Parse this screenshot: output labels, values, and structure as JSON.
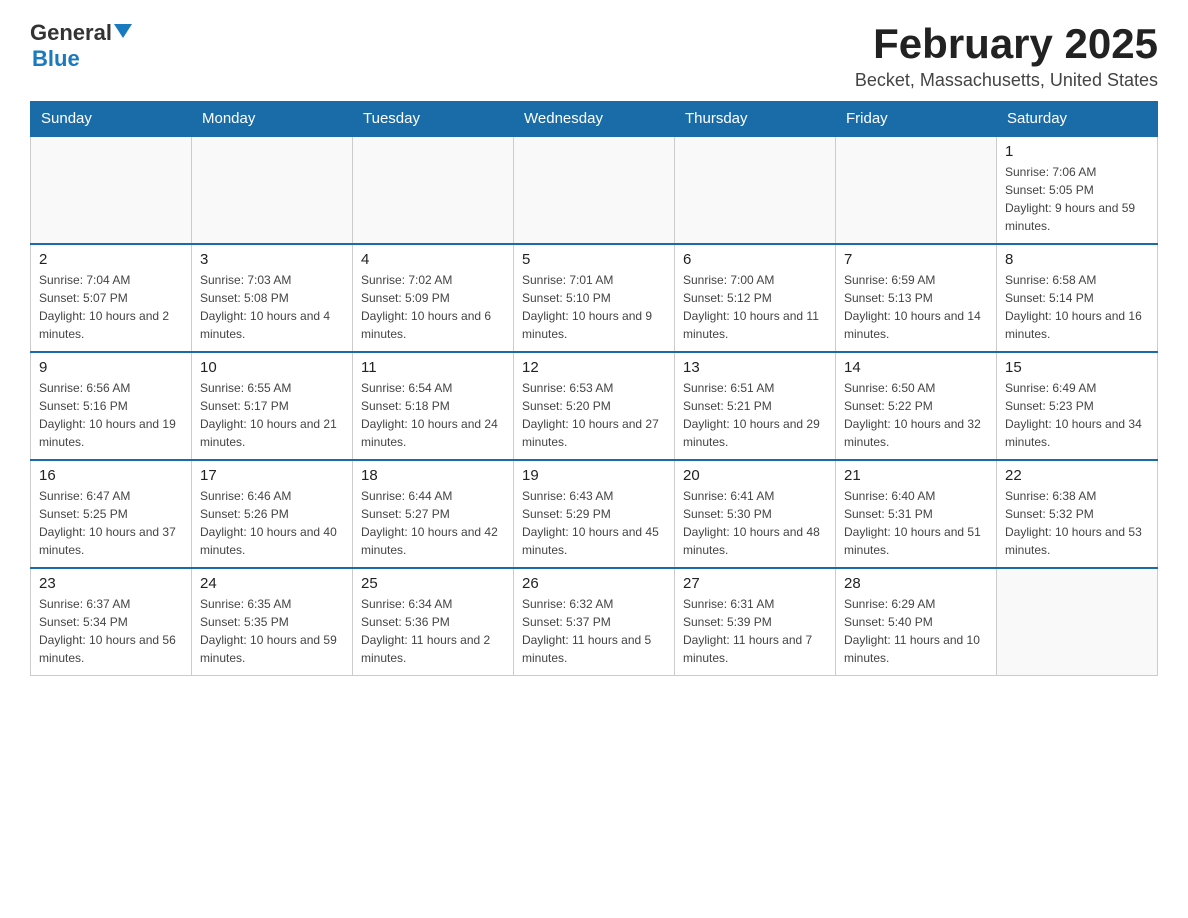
{
  "header": {
    "logo_general": "General",
    "logo_blue": "Blue",
    "month_title": "February 2025",
    "location": "Becket, Massachusetts, United States"
  },
  "weekdays": [
    "Sunday",
    "Monday",
    "Tuesday",
    "Wednesday",
    "Thursday",
    "Friday",
    "Saturday"
  ],
  "weeks": [
    [
      {
        "day": "",
        "info": ""
      },
      {
        "day": "",
        "info": ""
      },
      {
        "day": "",
        "info": ""
      },
      {
        "day": "",
        "info": ""
      },
      {
        "day": "",
        "info": ""
      },
      {
        "day": "",
        "info": ""
      },
      {
        "day": "1",
        "info": "Sunrise: 7:06 AM\nSunset: 5:05 PM\nDaylight: 9 hours and 59 minutes."
      }
    ],
    [
      {
        "day": "2",
        "info": "Sunrise: 7:04 AM\nSunset: 5:07 PM\nDaylight: 10 hours and 2 minutes."
      },
      {
        "day": "3",
        "info": "Sunrise: 7:03 AM\nSunset: 5:08 PM\nDaylight: 10 hours and 4 minutes."
      },
      {
        "day": "4",
        "info": "Sunrise: 7:02 AM\nSunset: 5:09 PM\nDaylight: 10 hours and 6 minutes."
      },
      {
        "day": "5",
        "info": "Sunrise: 7:01 AM\nSunset: 5:10 PM\nDaylight: 10 hours and 9 minutes."
      },
      {
        "day": "6",
        "info": "Sunrise: 7:00 AM\nSunset: 5:12 PM\nDaylight: 10 hours and 11 minutes."
      },
      {
        "day": "7",
        "info": "Sunrise: 6:59 AM\nSunset: 5:13 PM\nDaylight: 10 hours and 14 minutes."
      },
      {
        "day": "8",
        "info": "Sunrise: 6:58 AM\nSunset: 5:14 PM\nDaylight: 10 hours and 16 minutes."
      }
    ],
    [
      {
        "day": "9",
        "info": "Sunrise: 6:56 AM\nSunset: 5:16 PM\nDaylight: 10 hours and 19 minutes."
      },
      {
        "day": "10",
        "info": "Sunrise: 6:55 AM\nSunset: 5:17 PM\nDaylight: 10 hours and 21 minutes."
      },
      {
        "day": "11",
        "info": "Sunrise: 6:54 AM\nSunset: 5:18 PM\nDaylight: 10 hours and 24 minutes."
      },
      {
        "day": "12",
        "info": "Sunrise: 6:53 AM\nSunset: 5:20 PM\nDaylight: 10 hours and 27 minutes."
      },
      {
        "day": "13",
        "info": "Sunrise: 6:51 AM\nSunset: 5:21 PM\nDaylight: 10 hours and 29 minutes."
      },
      {
        "day": "14",
        "info": "Sunrise: 6:50 AM\nSunset: 5:22 PM\nDaylight: 10 hours and 32 minutes."
      },
      {
        "day": "15",
        "info": "Sunrise: 6:49 AM\nSunset: 5:23 PM\nDaylight: 10 hours and 34 minutes."
      }
    ],
    [
      {
        "day": "16",
        "info": "Sunrise: 6:47 AM\nSunset: 5:25 PM\nDaylight: 10 hours and 37 minutes."
      },
      {
        "day": "17",
        "info": "Sunrise: 6:46 AM\nSunset: 5:26 PM\nDaylight: 10 hours and 40 minutes."
      },
      {
        "day": "18",
        "info": "Sunrise: 6:44 AM\nSunset: 5:27 PM\nDaylight: 10 hours and 42 minutes."
      },
      {
        "day": "19",
        "info": "Sunrise: 6:43 AM\nSunset: 5:29 PM\nDaylight: 10 hours and 45 minutes."
      },
      {
        "day": "20",
        "info": "Sunrise: 6:41 AM\nSunset: 5:30 PM\nDaylight: 10 hours and 48 minutes."
      },
      {
        "day": "21",
        "info": "Sunrise: 6:40 AM\nSunset: 5:31 PM\nDaylight: 10 hours and 51 minutes."
      },
      {
        "day": "22",
        "info": "Sunrise: 6:38 AM\nSunset: 5:32 PM\nDaylight: 10 hours and 53 minutes."
      }
    ],
    [
      {
        "day": "23",
        "info": "Sunrise: 6:37 AM\nSunset: 5:34 PM\nDaylight: 10 hours and 56 minutes."
      },
      {
        "day": "24",
        "info": "Sunrise: 6:35 AM\nSunset: 5:35 PM\nDaylight: 10 hours and 59 minutes."
      },
      {
        "day": "25",
        "info": "Sunrise: 6:34 AM\nSunset: 5:36 PM\nDaylight: 11 hours and 2 minutes."
      },
      {
        "day": "26",
        "info": "Sunrise: 6:32 AM\nSunset: 5:37 PM\nDaylight: 11 hours and 5 minutes."
      },
      {
        "day": "27",
        "info": "Sunrise: 6:31 AM\nSunset: 5:39 PM\nDaylight: 11 hours and 7 minutes."
      },
      {
        "day": "28",
        "info": "Sunrise: 6:29 AM\nSunset: 5:40 PM\nDaylight: 11 hours and 10 minutes."
      },
      {
        "day": "",
        "info": ""
      }
    ]
  ]
}
